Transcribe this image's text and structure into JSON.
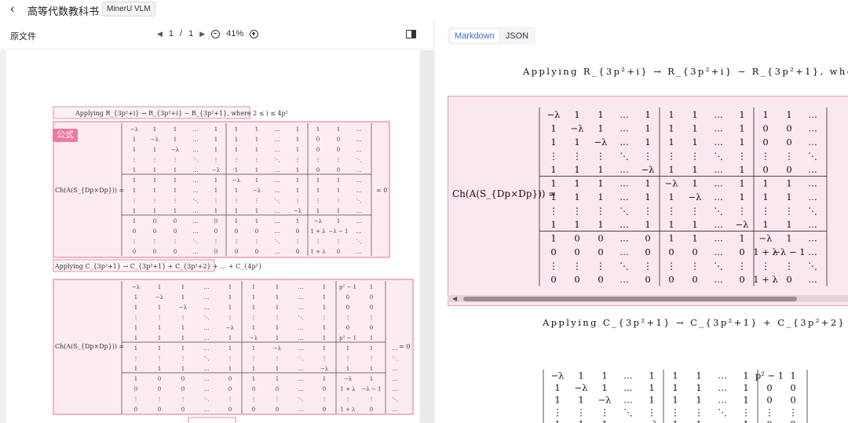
{
  "header": {
    "back_icon": "chevron-left-icon",
    "title": "高等代数教科书",
    "model_tag": "MinerU VLM"
  },
  "left": {
    "source_label": "原文件",
    "pager": {
      "current": "1",
      "sep": "/",
      "total": "1",
      "zoom": "41%"
    },
    "badge": "公式",
    "line1": "Applying R_{3p²+i} → R_{3p²+i} − R_{3p²+1}, where 2 ≤ i ≤ 4p²",
    "line2": "Applying C_{3p²+1} → C_{3p²+1} + C_{3p²+2} + … + C_{4p²}",
    "lhs": "Ch(A(S_{Dp×Dp})) =",
    "rhs": "= 0"
  },
  "right": {
    "tabs": [
      "Markdown",
      "JSON"
    ],
    "active_tab": "Markdown",
    "line1": "Applying R_{3p²+i} → R_{3p²+i} − R_{3p²+1}, where 2 ≤ i ≤ 4p²",
    "line2": "Applying C_{3p²+1} → C_{3p²+1} + C_{3p²+2} + ⋯ + C_{4p²}",
    "lhs": "Ch(A(S_{Dp×Dp})) ="
  },
  "matrix1_rows": [
    [
      "−λ",
      "1",
      "1",
      "…",
      "1",
      "1",
      "1",
      "…",
      "1",
      "1",
      "1",
      "…"
    ],
    [
      "1",
      "−λ",
      "1",
      "…",
      "1",
      "1",
      "1",
      "…",
      "1",
      "0",
      "0",
      "…"
    ],
    [
      "1",
      "1",
      "−λ",
      "…",
      "1",
      "1",
      "1",
      "…",
      "1",
      "0",
      "0",
      "…"
    ],
    [
      "⋮",
      "⋮",
      "⋮",
      "⋱",
      "⋮",
      "⋮",
      "⋮",
      "⋱",
      "⋮",
      "⋮",
      "⋮",
      "⋱"
    ],
    [
      "1",
      "1",
      "1",
      "…",
      "−λ",
      "1",
      "1",
      "…",
      "1",
      "0",
      "0",
      "…"
    ],
    [
      "1",
      "1",
      "1",
      "…",
      "1",
      "−λ",
      "1",
      "…",
      "1",
      "1",
      "1",
      "…"
    ],
    [
      "1",
      "1",
      "1",
      "…",
      "1",
      "1",
      "−λ",
      "…",
      "1",
      "1",
      "1",
      "…"
    ],
    [
      "⋮",
      "⋮",
      "⋮",
      "⋱",
      "⋮",
      "⋮",
      "⋮",
      "⋱",
      "⋮",
      "⋮",
      "⋮",
      "⋱"
    ],
    [
      "1",
      "1",
      "1",
      "…",
      "1",
      "1",
      "1",
      "…",
      "−λ",
      "1",
      "1",
      "…"
    ],
    [
      "1",
      "0",
      "0",
      "…",
      "0",
      "1",
      "1",
      "…",
      "1",
      "−λ",
      "1",
      "…"
    ],
    [
      "0",
      "0",
      "0",
      "…",
      "0",
      "0",
      "0",
      "…",
      "0",
      "1 + λ",
      "−λ − 1",
      "…"
    ],
    [
      "⋮",
      "⋮",
      "⋮",
      "⋱",
      "⋮",
      "⋮",
      "⋮",
      "⋱",
      "⋮",
      "⋮",
      "⋮",
      "⋱"
    ],
    [
      "0",
      "0",
      "0",
      "…",
      "0",
      "0",
      "0",
      "…",
      "0",
      "1 + λ",
      "0",
      "…"
    ]
  ],
  "matrix2_rows": [
    [
      "−λ",
      "1",
      "1",
      "…",
      "1",
      "1",
      "1",
      "…",
      "1",
      "p² − 1",
      "1"
    ],
    [
      "1",
      "−λ",
      "1",
      "…",
      "1",
      "1",
      "1",
      "…",
      "1",
      "0",
      "0"
    ],
    [
      "1",
      "1",
      "−λ",
      "…",
      "1",
      "1",
      "1",
      "…",
      "1",
      "0",
      "0"
    ],
    [
      "⋮",
      "⋮",
      "⋮",
      "⋱",
      "⋮",
      "⋮",
      "⋮",
      "⋱",
      "⋮",
      "⋮",
      "⋮"
    ],
    [
      "1",
      "1",
      "1",
      "…",
      "−λ",
      "1",
      "1",
      "…",
      "1",
      "0",
      "0"
    ],
    [
      "1",
      "1",
      "1",
      "…",
      "1",
      "−λ",
      "1",
      "…",
      "1",
      "p² − 1",
      "1"
    ]
  ]
}
